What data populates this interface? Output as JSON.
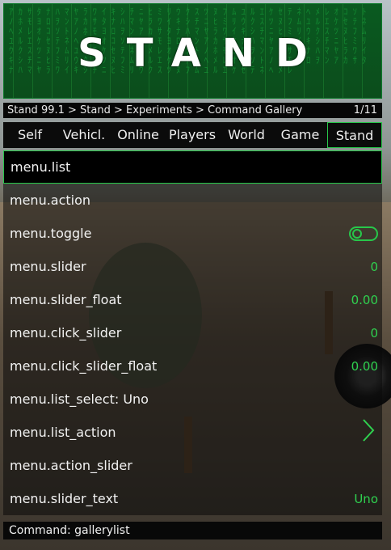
{
  "banner": {
    "title": "STAND"
  },
  "breadcrumb": {
    "path": "Stand 99.1 > Stand > Experiments > Command Gallery",
    "position": "1/11"
  },
  "tabs": [
    {
      "label": "Self",
      "active": false
    },
    {
      "label": "Vehicl.",
      "active": false
    },
    {
      "label": "Online",
      "active": false
    },
    {
      "label": "Players",
      "active": false
    },
    {
      "label": "World",
      "active": false
    },
    {
      "label": "Game",
      "active": false
    },
    {
      "label": "Stand",
      "active": true
    }
  ],
  "items": [
    {
      "label": "menu.list",
      "value": "",
      "selected": true
    },
    {
      "label": "menu.action",
      "value": ""
    },
    {
      "label": "menu.toggle",
      "value": "",
      "icon": "toggle-off-icon"
    },
    {
      "label": "menu.slider",
      "value": "0"
    },
    {
      "label": "menu.slider_float",
      "value": "0.00"
    },
    {
      "label": "menu.click_slider",
      "value": "0"
    },
    {
      "label": "menu.click_slider_float",
      "value": "0.00"
    },
    {
      "label": "menu.list_select: Uno",
      "value": ""
    },
    {
      "label": "menu.list_action",
      "value": "",
      "icon": "chevron-right-icon"
    },
    {
      "label": "menu.action_slider",
      "value": ""
    },
    {
      "label": "menu.slider_text",
      "value": "Uno"
    }
  ],
  "command": {
    "text": "Command: gallerylist"
  },
  "colors": {
    "accent": "#27c74a",
    "panel": "#0b0b0b",
    "banner": "#0b4d1c"
  }
}
